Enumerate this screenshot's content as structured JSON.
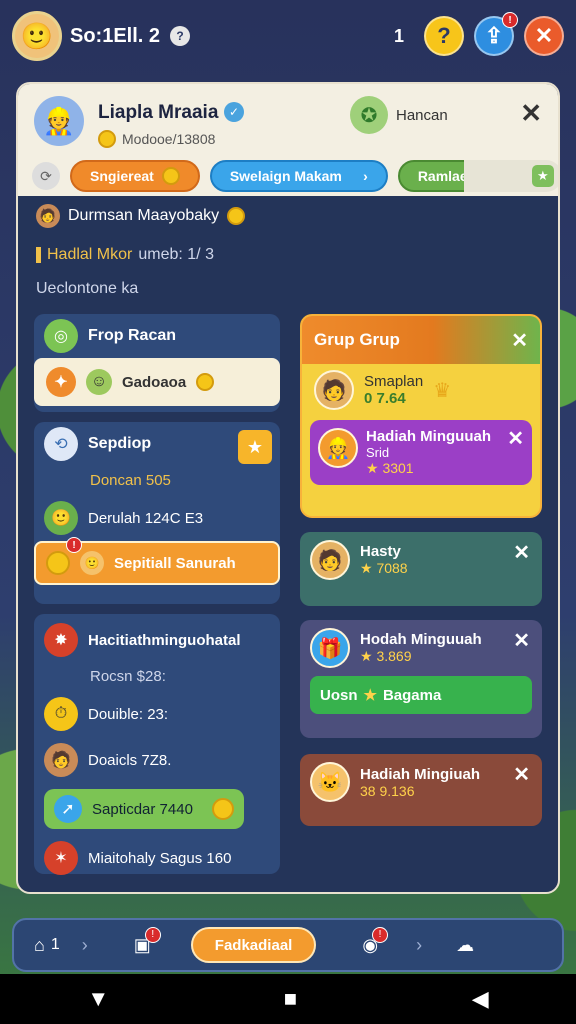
{
  "topbar": {
    "score": "So:1Ell. 2",
    "count": "1",
    "avatar_icon": "player-avatar"
  },
  "panel": {
    "name": "Liapla Mraaia",
    "subtitle": "Modooe/13808",
    "right_label": "Hancan",
    "tabs": [
      "Sngiereat",
      "Swelaign Makam",
      "Ramlae"
    ],
    "info_name": "Durmsan Maayobaky",
    "info_line2_a": "Hadlal Mkor",
    "info_line2_b": "umeb: 1/ 3",
    "info_line3": "Ueclontone ka"
  },
  "left": {
    "card1_title": "Frop Racan",
    "card1_cream": "Gadoaoa",
    "card2_title": "Sepdiop",
    "card2_line1": "Doncan 505",
    "card2_line2": "Derulah 124C E3",
    "card2_btn": "Sepitiall Sanurah",
    "card3_title": "Hacitiathminguohatal",
    "card3_line1": "Rocsn $28:",
    "card3_line2": "Douible: 23:",
    "card3_line3": "Doaicls 7Z8.",
    "card3_btn": "Sapticdar 7440",
    "card3_line4": "Miaitohaly Sagus 160"
  },
  "right": {
    "group_title": "Grup Grup",
    "group_item1_name": "Smaplan",
    "group_item1_value": "0 7.64",
    "purple_title": "Hadiah Minguuah",
    "purple_sub": "Srid",
    "purple_value": "3301",
    "teal_title": "Hasty",
    "teal_value": "7088",
    "violet_title": "Hodah Minguuah",
    "violet_value": "3.869",
    "violet_btn_a": "Uosn",
    "violet_btn_b": "Bagama",
    "brown_title": "Hadiah Mingiuah",
    "brown_value": "38 9.136"
  },
  "bottom": {
    "home_count": "1",
    "main_button": "Fadkadiaal"
  },
  "colors": {
    "accent_orange": "#f39b2e",
    "panel_bg": "#243459",
    "green": "#37b24d",
    "purple": "#9b3fc6"
  }
}
